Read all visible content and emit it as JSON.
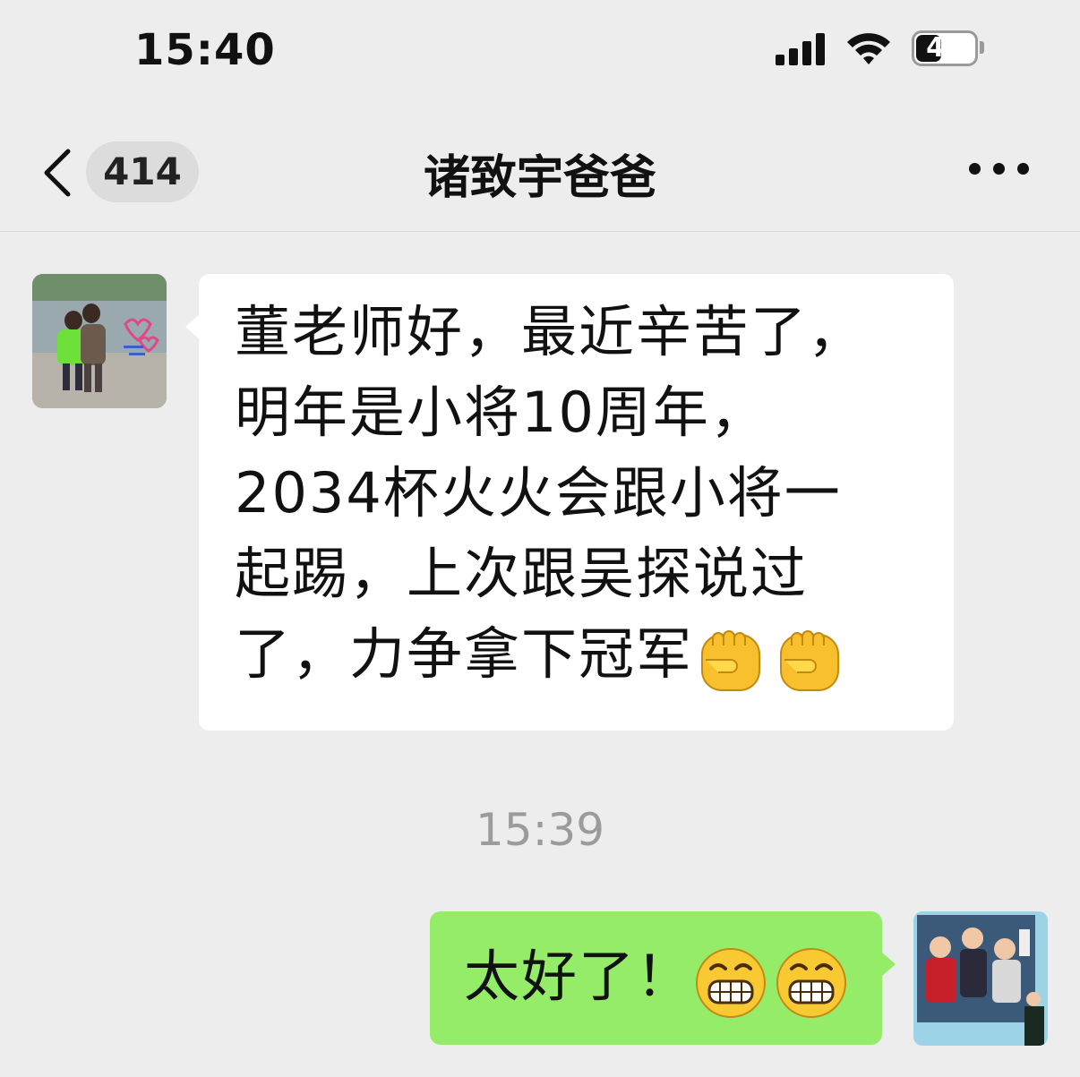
{
  "status_bar": {
    "time": "15:40",
    "battery_percent": "43",
    "battery_level": 0.43
  },
  "nav": {
    "back_count": "414",
    "title": "诸致宇爸爸"
  },
  "messages": [
    {
      "side": "incoming",
      "text": "董老师好，最近辛苦了，\n明年是小将10周年，\n2034杯火火会跟小将一\n起踢，上次跟吴探说过\n了，力争拿下冠军",
      "emoji": [
        "raised-fist-icon",
        "raised-fist-icon"
      ]
    },
    {
      "side": "outgoing",
      "text": "太好了！",
      "emoji": [
        "grinning-face-icon",
        "grinning-face-icon"
      ]
    }
  ],
  "timestamp": "15:39",
  "colors": {
    "background": "#ededed",
    "incoming_bubble": "#ffffff",
    "outgoing_bubble": "#95ec69"
  }
}
